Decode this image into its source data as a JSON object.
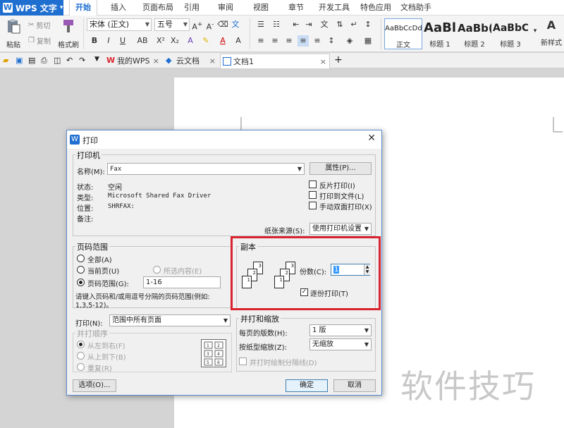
{
  "app": {
    "name": "WPS 文字",
    "tabs": [
      "开始",
      "插入",
      "页面布局",
      "引用",
      "审阅",
      "视图",
      "章节",
      "开发工具",
      "特色应用",
      "文档助手"
    ],
    "active_tab": "开始"
  },
  "ribbon": {
    "paste": "粘贴",
    "cut": "剪切",
    "copy": "复制",
    "format_painter": "格式刷",
    "font_name": "宋体 (正文)",
    "font_size": "五号",
    "styles": [
      {
        "sample": "AaBbCcDd",
        "label": "正文"
      },
      {
        "sample": "AaBl",
        "label": "标题 1"
      },
      {
        "sample": "AaBb(",
        "label": "标题 2"
      },
      {
        "sample": "AaBbC",
        "label": "标题 3"
      }
    ],
    "new_style": "新样式"
  },
  "doc_tabs": [
    {
      "label": "我的WPS"
    },
    {
      "label": "云文档"
    },
    {
      "label": "文档1"
    }
  ],
  "dialog": {
    "title": "打印",
    "printer": {
      "legend": "打印机",
      "name_label": "名称(M):",
      "name_value": "Fax",
      "properties": "属性(P)...",
      "status_label": "状态:",
      "status_value": "空闲",
      "type_label": "类型:",
      "type_value": "Microsoft Shared Fax Driver",
      "location_label": "位置:",
      "location_value": "SHRFAX:",
      "comment_label": "备注:",
      "reverse_print": "反片打印(I)",
      "print_to_file": "打印到文件(L)",
      "manual_duplex": "手动双面打印(X)",
      "paper_source_label": "纸张来源(S):",
      "paper_source_value": "使用打印机设置"
    },
    "page_range": {
      "legend": "页码范围",
      "all": "全部(A)",
      "current": "当前页(U)",
      "selection": "所选内容(E)",
      "pages": "页码范围(G):",
      "pages_value": "1-16",
      "hint": "请键入页码和/或用逗号分隔的页码范围(例如:",
      "hint2": "1,3,5-12)。"
    },
    "print_what_label": "打印(N):",
    "print_what_value": "范围中所有页面",
    "order": {
      "legend": "并打顺序",
      "ltr": "从左到右(F)",
      "ttb": "从上到下(B)",
      "repeat": "重复(R)"
    },
    "copies": {
      "legend": "副本",
      "count_label": "份数(C):",
      "count_value": "1",
      "collate": "逐份打印(T)"
    },
    "zoom": {
      "legend": "并打和缩放",
      "per_sheet_label": "每页的版数(H):",
      "per_sheet_value": "1 版",
      "scale_label": "按纸型缩放(Z):",
      "scale_value": "无缩放",
      "draw_borders": "并打时绘制分隔线(D)"
    },
    "options": "选项(O)...",
    "ok": "确定",
    "cancel": "取消"
  },
  "watermark": "软件技巧",
  "colors": {
    "accent": "#1f6fd1",
    "highlight": "#d9232e"
  }
}
